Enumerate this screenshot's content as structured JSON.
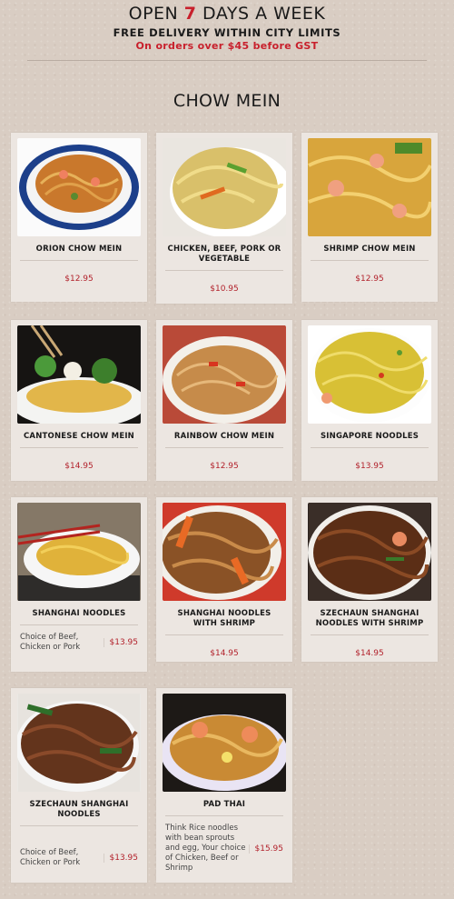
{
  "header": {
    "open_before": "OPEN ",
    "open_num": "7",
    "open_after": " DAYS A WEEK",
    "free_delivery": "FREE DELIVERY WITHIN CITY LIMITS",
    "orders": "On orders over $45 before GST"
  },
  "section": {
    "title": "CHOW MEIN"
  },
  "items": [
    {
      "name": "ORION CHOW MEIN",
      "price": "$12.95"
    },
    {
      "name": "CHICKEN, BEEF, PORK OR VEGETABLE",
      "price": "$10.95"
    },
    {
      "name": "SHRIMP CHOW MEIN",
      "price": "$12.95"
    },
    {
      "name": "CANTONESE CHOW MEIN",
      "price": "$14.95"
    },
    {
      "name": "RAINBOW CHOW MEIN",
      "price": "$12.95"
    },
    {
      "name": "SINGAPORE NOODLES",
      "price": "$13.95"
    },
    {
      "name": "SHANGHAI NOODLES",
      "desc": "Choice of Beef, Chicken or Pork",
      "price": "$13.95"
    },
    {
      "name": "SHANGHAI NOODLES WITH SHRIMP",
      "price": "$14.95"
    },
    {
      "name": "SZECHAUN SHANGHAI NOODLES WITH SHRIMP",
      "price": "$14.95"
    },
    {
      "name": "SZECHAUN SHANGHAI NOODLES",
      "desc": "Choice of Beef, Chicken or Pork",
      "price": "$13.95"
    },
    {
      "name": "PAD THAI",
      "desc": "Think Rice noodles with bean sprouts and egg, Your choice of Chicken, Beef or Shrimp",
      "price": "$15.95"
    }
  ],
  "colors": {
    "accent": "#c8202c",
    "price": "#b2222c",
    "card": "#ece6e1"
  }
}
